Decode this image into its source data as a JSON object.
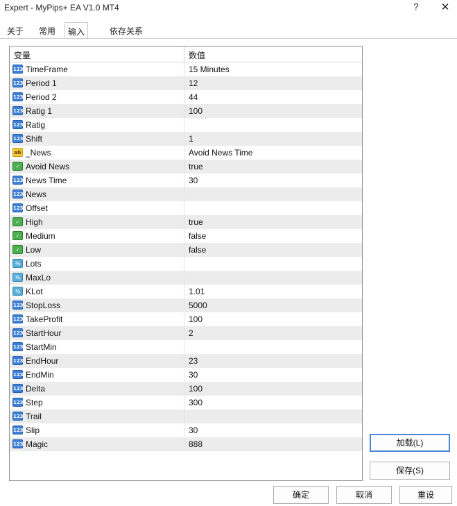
{
  "window": {
    "title": "Expert - MyPips+ EA V1.0 MT4",
    "help": "?",
    "close": "✕"
  },
  "tabs": [
    {
      "label": "关于"
    },
    {
      "label": "常用"
    },
    {
      "label": "输入"
    },
    {
      "label": "依存关系"
    }
  ],
  "grid": {
    "col_variable": "变量",
    "col_value": "数值",
    "rows": [
      {
        "type": "int",
        "icon_text": "123",
        "name": "TimeFrame",
        "value": "15 Minutes"
      },
      {
        "type": "int",
        "icon_text": "123",
        "name": "Period 1",
        "value": "12"
      },
      {
        "type": "int",
        "icon_text": "123",
        "name": "Period 2",
        "value": "44"
      },
      {
        "type": "int",
        "icon_text": "123",
        "name": "Ratig 1",
        "value": "100"
      },
      {
        "type": "int",
        "icon_text": "123",
        "name": "Ratig",
        "value": ""
      },
      {
        "type": "int",
        "icon_text": "123",
        "name": "Shift",
        "value": "1"
      },
      {
        "type": "str",
        "icon_text": "ab",
        "name": "_News",
        "value": "Avoid News Time"
      },
      {
        "type": "bool",
        "icon_text": "✓",
        "name": "Avoid News",
        "value": "true"
      },
      {
        "type": "int",
        "icon_text": "123",
        "name": "News Time",
        "value": "30"
      },
      {
        "type": "int",
        "icon_text": "123",
        "name": "News",
        "value": ""
      },
      {
        "type": "int",
        "icon_text": "123",
        "name": "Offset",
        "value": ""
      },
      {
        "type": "bool",
        "icon_text": "✓",
        "name": "High",
        "value": "true"
      },
      {
        "type": "bool",
        "icon_text": "✓",
        "name": "Medium",
        "value": "false"
      },
      {
        "type": "bool",
        "icon_text": "✓",
        "name": "Low",
        "value": "false"
      },
      {
        "type": "dbl",
        "icon_text": "½",
        "name": "Lots",
        "value": ""
      },
      {
        "type": "dbl",
        "icon_text": "½",
        "name": "MaxLo",
        "value": ""
      },
      {
        "type": "dbl",
        "icon_text": "½",
        "name": "KLot",
        "value": "1.01"
      },
      {
        "type": "int",
        "icon_text": "123",
        "name": "StopLoss",
        "value": "5000"
      },
      {
        "type": "int",
        "icon_text": "123",
        "name": "TakeProfit",
        "value": "100"
      },
      {
        "type": "int",
        "icon_text": "123",
        "name": "StartHour",
        "value": "2"
      },
      {
        "type": "int",
        "icon_text": "123",
        "name": "StartMin",
        "value": ""
      },
      {
        "type": "int",
        "icon_text": "123",
        "name": "EndHour",
        "value": "23"
      },
      {
        "type": "int",
        "icon_text": "123",
        "name": "EndMin",
        "value": "30"
      },
      {
        "type": "int",
        "icon_text": "123",
        "name": "Delta",
        "value": "100"
      },
      {
        "type": "int",
        "icon_text": "123",
        "name": "Step",
        "value": "300"
      },
      {
        "type": "int",
        "icon_text": "123",
        "name": "Trail",
        "value": ""
      },
      {
        "type": "int",
        "icon_text": "123",
        "name": "Slip",
        "value": "30"
      },
      {
        "type": "int",
        "icon_text": "123",
        "name": "Magic",
        "value": "888"
      }
    ]
  },
  "buttons": {
    "load": "加载(L)",
    "save": "保存(S)",
    "ok": "确定",
    "cancel": "取消",
    "reset": "重设"
  }
}
